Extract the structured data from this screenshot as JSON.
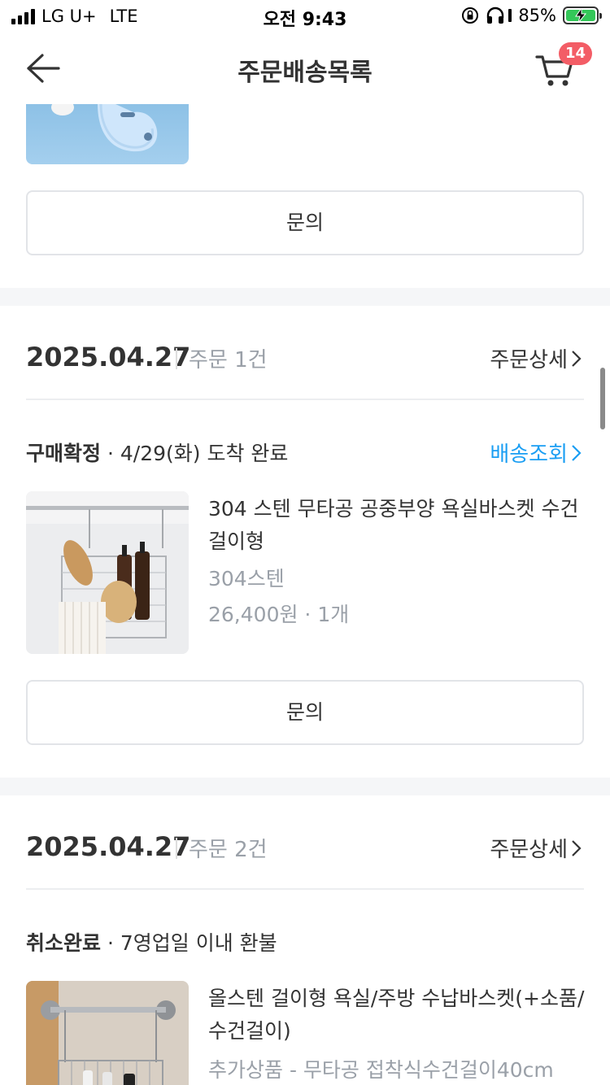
{
  "status_bar": {
    "carrier": "LG U+",
    "network": "LTE",
    "time": "오전 9:43",
    "battery": "85%"
  },
  "header": {
    "title": "주문배송목록",
    "cart_count": "14"
  },
  "top_block": {
    "inquiry_label": "문의"
  },
  "orders": [
    {
      "date": "2025.04.27",
      "count": "주문 1건",
      "detail_label": "주문상세",
      "status": "구매확정",
      "status_note": "· 4/29(화) 도착 완료",
      "track_label": "배송조회",
      "product": {
        "name": "304 스텐 무타공 공중부양 욕실바스켓 수건걸이형",
        "option": "304스텐",
        "price": "26,400원 · 1개"
      },
      "inquiry_label": "문의"
    },
    {
      "date": "2025.04.27",
      "count": "주문 2건",
      "detail_label": "주문상세",
      "status": "취소완료",
      "status_note": "· 7영업일 이내 환불",
      "product": {
        "name": "올스텐 걸이형 욕실/주방 수납바스켓(+소품/수건걸이)",
        "option": "추가상품 - 무타공 접착식수건걸이40cm"
      }
    }
  ],
  "colors": {
    "accent_link": "#1a9ef3",
    "badge": "#f35d66",
    "band": "#f5f6f8"
  }
}
